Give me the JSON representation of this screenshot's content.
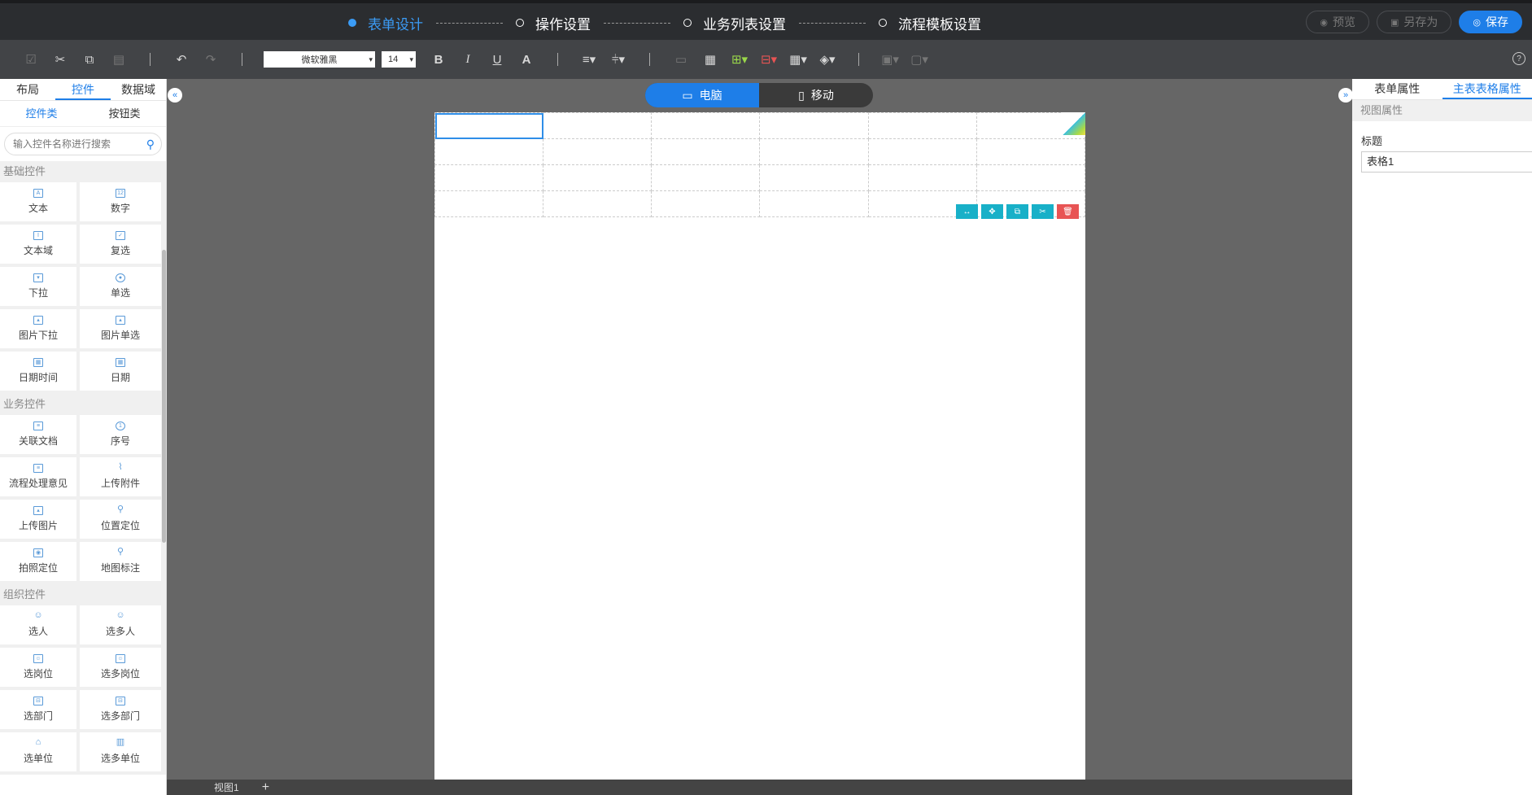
{
  "header": {
    "steps": [
      {
        "label": "表单设计",
        "active": true
      },
      {
        "label": "操作设置",
        "active": false
      },
      {
        "label": "业务列表设置",
        "active": false
      },
      {
        "label": "流程模板设置",
        "active": false
      }
    ],
    "preview_label": "预览",
    "save_as_label": "另存为",
    "save_label": "保存"
  },
  "toolbar": {
    "font_family": "微软雅黑",
    "font_size": "14",
    "bold": "B",
    "italic": "I",
    "underline": "U",
    "font_color": "A"
  },
  "left": {
    "tabs": [
      "布局",
      "控件",
      "数据域"
    ],
    "active_tab": "控件",
    "subtabs": [
      "控件类",
      "按钮类"
    ],
    "search_placeholder": "输入控件名称进行搜索",
    "sections": [
      {
        "title": "基础控件",
        "items": [
          "文本",
          "数字",
          "文本域",
          "复选",
          "下拉",
          "单选",
          "图片下拉",
          "图片单选",
          "日期时间",
          "日期"
        ]
      },
      {
        "title": "业务控件",
        "items": [
          "关联文档",
          "序号",
          "流程处理意见",
          "上传附件",
          "上传图片",
          "位置定位",
          "拍照定位",
          "地图标注"
        ]
      },
      {
        "title": "组织控件",
        "items": [
          "选人",
          "选多人",
          "选岗位",
          "选多岗位",
          "选部门",
          "选多部门",
          "选单位",
          "选多单位"
        ]
      }
    ]
  },
  "view_toggle": {
    "desktop": "电脑",
    "mobile": "移动",
    "active": "电脑"
  },
  "sheet_tabs": [
    "视图1"
  ],
  "right": {
    "tabs": [
      "表单属性",
      "主表表格属性"
    ],
    "active_tab": "主表表格属性",
    "section": "视图属性",
    "title_label": "标题",
    "title_value": "表格1"
  },
  "colors": {
    "accent": "#1e7ee8",
    "header_bg": "#2b2d30",
    "toolbar_bg": "#424447",
    "canvas_bg": "#666666",
    "delete": "#e85454",
    "action": "#18b0c8"
  }
}
